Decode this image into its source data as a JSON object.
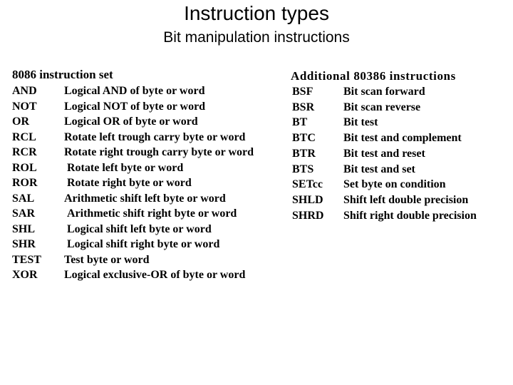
{
  "title": "Instruction types",
  "subtitle": "Bit manipulation instructions",
  "left_section": {
    "heading": "8086 instruction set",
    "rows": [
      {
        "mnemonic": "AND",
        "description": "Logical AND of byte or word"
      },
      {
        "mnemonic": "NOT",
        "description": "Logical NOT of byte or word"
      },
      {
        "mnemonic": "OR",
        "description": "Logical OR of byte or word"
      },
      {
        "mnemonic": "RCL",
        "description": "Rotate left trough carry byte or word"
      },
      {
        "mnemonic": "RCR",
        "description": "Rotate right trough carry byte or word"
      },
      {
        "mnemonic": "ROL",
        "description": "Rotate left byte or word"
      },
      {
        "mnemonic": "ROR",
        "description": "Rotate right byte or word"
      },
      {
        "mnemonic": "SAL",
        "description": "Arithmetic shift left byte or word"
      },
      {
        "mnemonic": "SAR",
        "description": "Arithmetic shift right byte or word"
      },
      {
        "mnemonic": "SHL",
        "description": "Logical shift left byte or word"
      },
      {
        "mnemonic": "SHR",
        "description": "Logical shift right byte or word"
      },
      {
        "mnemonic": "TEST",
        "description": "Test byte or word"
      },
      {
        "mnemonic": "XOR",
        "description": "Logical exclusive-OR of byte or word"
      }
    ]
  },
  "right_section": {
    "heading": "Additional 80386 instructions",
    "rows": [
      {
        "mnemonic": "BSF",
        "description": "Bit scan forward"
      },
      {
        "mnemonic": "BSR",
        "description": "Bit scan reverse"
      },
      {
        "mnemonic": "BT",
        "description": "Bit test"
      },
      {
        "mnemonic": "BTC",
        "description": "Bit test and complement"
      },
      {
        "mnemonic": "BTR",
        "description": "Bit test and reset"
      },
      {
        "mnemonic": "BTS",
        "description": "Bit test and set"
      },
      {
        "mnemonic": "SETcc",
        "description": "Set byte on condition"
      },
      {
        "mnemonic": "SHLD",
        "description": "Shift left double precision"
      },
      {
        "mnemonic": "SHRD",
        "description": "Shift right double precision"
      }
    ]
  }
}
